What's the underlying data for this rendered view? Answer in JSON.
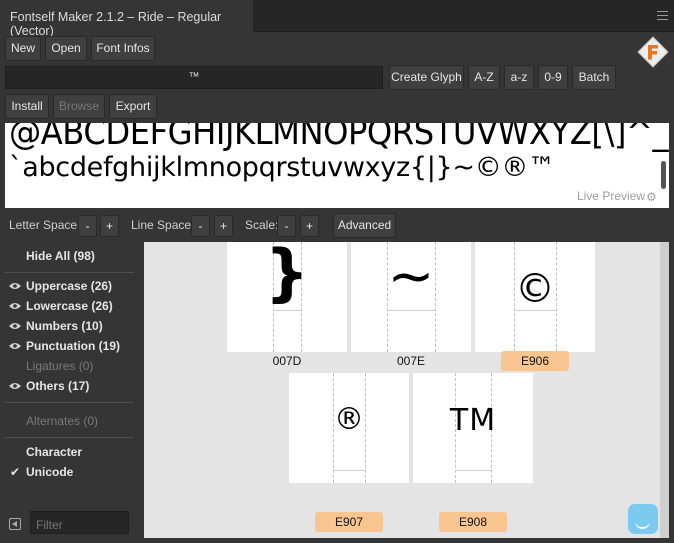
{
  "window": {
    "title": "Fontself Maker 2.1.2 – Ride – Regular (Vector)"
  },
  "toolbar1": {
    "new": "New",
    "open": "Open",
    "font_infos": "Font Infos"
  },
  "glyph_input": {
    "value": "™"
  },
  "toolbar2": {
    "create_glyph": "Create Glyph",
    "az_upper": "A-Z",
    "az_lower": "a-z",
    "digits": "0-9",
    "batch": "Batch"
  },
  "toolbar3": {
    "install": "Install",
    "browse": "Browse",
    "export": "Export"
  },
  "preview": {
    "line1": "@ABCDEFGHIJKLMNOPQRSTUVWXYZ[\\]^_",
    "line2": "`abcdefghijklmnopqrstuvwxyz{|}~©®™",
    "live_preview": "Live Preview"
  },
  "controls": {
    "letter_space": "Letter Space:",
    "line_space": "Line Space:",
    "scale": "Scale:",
    "minus": "-",
    "plus": "+",
    "advanced": "Advanced"
  },
  "sidebar": {
    "hide_all": "Hide All (98)",
    "categories": [
      {
        "label": "Uppercase (26)",
        "visible": true
      },
      {
        "label": "Lowercase (26)",
        "visible": true
      },
      {
        "label": "Numbers (10)",
        "visible": true
      },
      {
        "label": "Punctuation (19)",
        "visible": true
      },
      {
        "label": "Ligatures (0)",
        "visible": false
      },
      {
        "label": "Others (17)",
        "visible": true
      }
    ],
    "alternates": "Alternates (0)",
    "sort_header": "Character",
    "sort_option": "Unicode",
    "filter_placeholder": "Filter"
  },
  "glyphs": [
    {
      "char": "}",
      "code": "007D",
      "selected": false
    },
    {
      "char": "~",
      "code": "007E",
      "selected": false
    },
    {
      "char": "©",
      "code": "E906",
      "selected": true
    },
    {
      "char": "®",
      "code": "E907",
      "selected": true
    },
    {
      "char": "TM",
      "code": "E908",
      "selected": true
    }
  ],
  "colors": {
    "accent_label": "#f8c591",
    "chat": "#7dcaf0"
  }
}
